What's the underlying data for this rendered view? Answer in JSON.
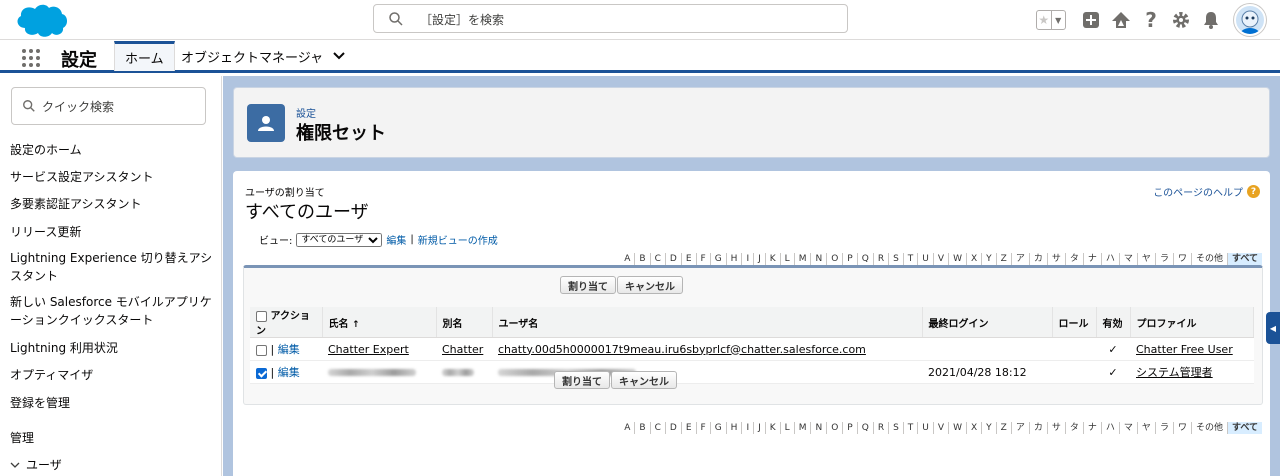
{
  "header": {
    "search_placeholder": "［設定］を検索"
  },
  "nav": {
    "app_name": "設定",
    "tabs": [
      {
        "label": "ホーム"
      },
      {
        "label": "オブジェクトマネージャ"
      }
    ]
  },
  "sidebar": {
    "search_placeholder": "クイック検索",
    "items": [
      {
        "label": "設定のホーム"
      },
      {
        "label": "サービス設定アシスタント"
      },
      {
        "label": "多要素認証アシスタント"
      },
      {
        "label": "リリース更新"
      },
      {
        "label": "Lightning Experience 切り替えアシスタント"
      },
      {
        "label": "新しい Salesforce モバイルアプリケーションクイックスタート"
      },
      {
        "label": "Lightning 利用状況"
      },
      {
        "label": "オプティマイザ"
      },
      {
        "label": "登録を管理"
      }
    ],
    "section": "管理",
    "subsection": "ユーザ"
  },
  "page_header": {
    "breadcrumb": "設定",
    "title": "権限セット"
  },
  "content": {
    "subtitle": "ユーザの割り当て",
    "title": "すべてのユーザ",
    "help_link": "このページのヘルプ",
    "view_label": "ビュー:",
    "view_selected": "すべてのユーザ",
    "edit_link": "編集",
    "new_view_link": "新規ビューの作成",
    "separator": "|",
    "alphabet": [
      "A",
      "B",
      "C",
      "D",
      "E",
      "F",
      "G",
      "H",
      "I",
      "J",
      "K",
      "L",
      "M",
      "N",
      "O",
      "P",
      "Q",
      "R",
      "S",
      "T",
      "U",
      "V",
      "W",
      "X",
      "Y",
      "Z",
      "ア",
      "カ",
      "サ",
      "タ",
      "ナ",
      "ハ",
      "マ",
      "ヤ",
      "ラ",
      "ワ",
      "その他",
      "すべて"
    ],
    "assign_button": "割り当て",
    "cancel_button": "キャンセル",
    "columns": {
      "action": "アクション",
      "name": "氏名",
      "sort_indicator": "↑",
      "alias": "別名",
      "username": "ユーザ名",
      "last_login": "最終ログイン",
      "role": "ロール",
      "active": "有効",
      "profile": "プロファイル"
    },
    "rows": [
      {
        "edit": "編集",
        "name": "Chatter Expert",
        "alias": "Chatter",
        "username": "chatty.00d5h0000017t9meau.iru6sbyprlcf@chatter.salesforce.com",
        "last_login": "",
        "active": "✓",
        "profile": "Chatter Free User",
        "checked": false
      },
      {
        "edit": "編集",
        "name": "",
        "alias": "",
        "username": "",
        "last_login": "2021/04/28 18:12",
        "active": "✓",
        "profile": "システム管理者",
        "checked": true
      }
    ]
  },
  "colors": {
    "brand_blue": "#1b5297",
    "link_blue": "#015ba7",
    "page_bg": "#b0c4df"
  }
}
